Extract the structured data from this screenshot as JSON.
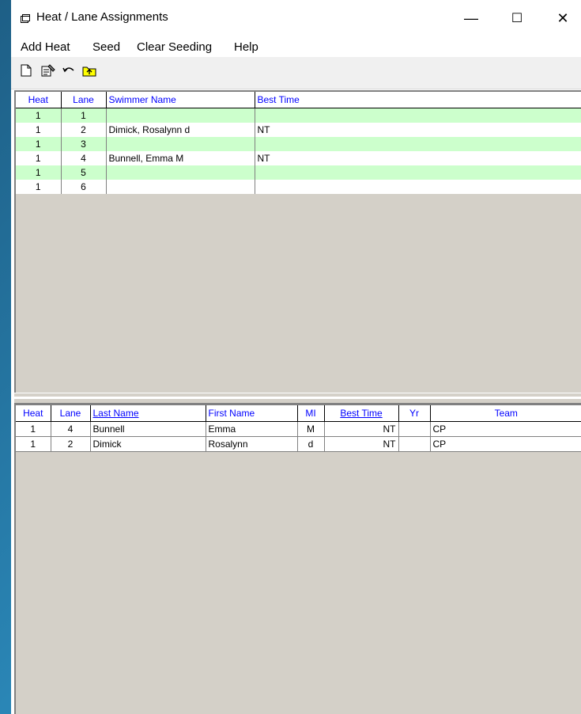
{
  "window": {
    "title": "Heat / Lane Assignments",
    "minimize_glyph": "—",
    "maximize_glyph": "☐",
    "close_glyph": "✕"
  },
  "menu": {
    "add_heat": "Add Heat",
    "seed": "Seed",
    "clear_seeding": "Clear Seeding",
    "help": "Help"
  },
  "toolbar": {
    "icons": [
      "new-page-icon",
      "properties-icon",
      "undo-icon",
      "folder-up-icon"
    ]
  },
  "top_grid": {
    "headers": [
      "Heat",
      "Lane",
      "Swimmer Name",
      "Best Time"
    ],
    "rows": [
      {
        "heat": "1",
        "lane": "1",
        "name": "",
        "best": ""
      },
      {
        "heat": "1",
        "lane": "2",
        "name": "Dimick, Rosalynn d",
        "best": "NT"
      },
      {
        "heat": "1",
        "lane": "3",
        "name": "",
        "best": ""
      },
      {
        "heat": "1",
        "lane": "4",
        "name": "Bunnell, Emma M",
        "best": "NT"
      },
      {
        "heat": "1",
        "lane": "5",
        "name": "",
        "best": ""
      },
      {
        "heat": "1",
        "lane": "6",
        "name": "",
        "best": ""
      }
    ]
  },
  "bottom_grid": {
    "headers": [
      "Heat",
      "Lane",
      "Last Name",
      "First Name",
      "MI",
      "Best Time",
      "Yr",
      "Team"
    ],
    "rows": [
      {
        "heat": "1",
        "lane": "4",
        "last": "Bunnell",
        "first": "Emma",
        "mi": "M",
        "best": "NT",
        "yr": "",
        "team": "CP"
      },
      {
        "heat": "1",
        "lane": "2",
        "last": "Dimick",
        "first": "Rosalynn",
        "mi": "d",
        "best": "NT",
        "yr": "",
        "team": "CP"
      }
    ]
  },
  "colors": {
    "row_highlight": "#ccffcc",
    "header_text": "#0000ff",
    "pane_background": "#d4d0c8"
  }
}
